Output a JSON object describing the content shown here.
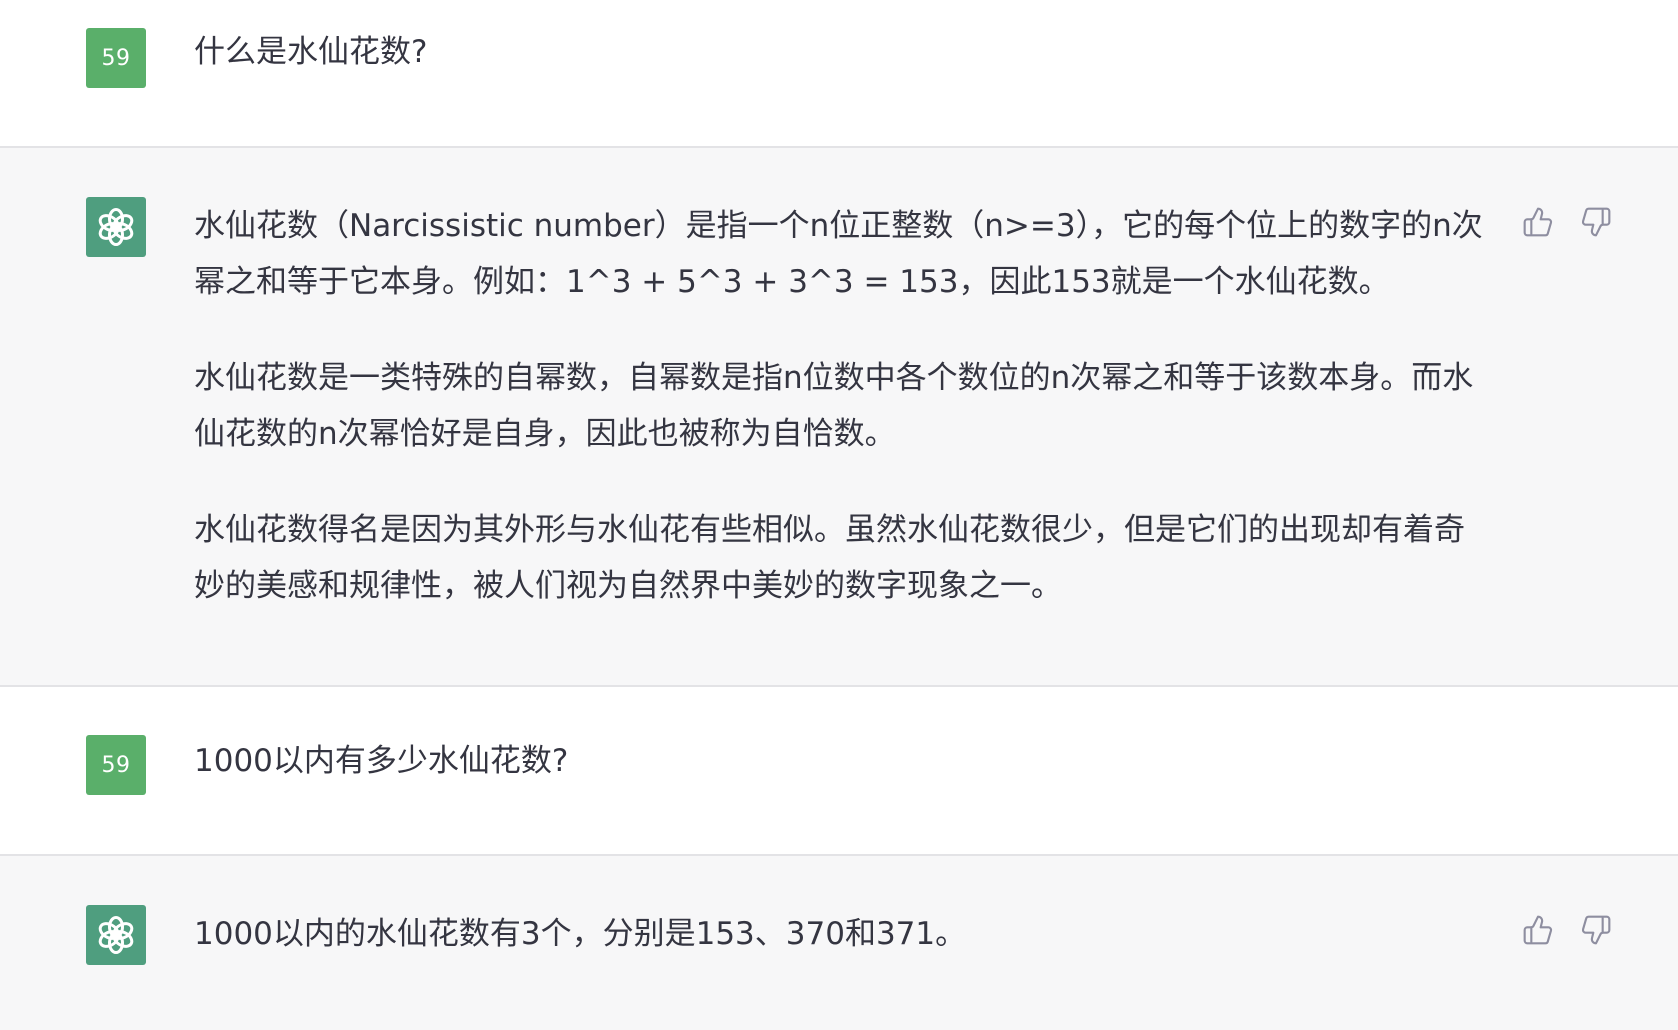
{
  "conversation": [
    {
      "role": "user",
      "avatar_text": "59",
      "paragraphs": [
        "什么是水仙花数?"
      ]
    },
    {
      "role": "assistant",
      "avatar_icon": "openai-logo-icon",
      "paragraphs": [
        "水仙花数（Narcissistic number）是指一个n位正整数（n>=3），它的每个位上的数字的n次幂之和等于它本身。例如：1^3 + 5^3 + 3^3 = 153，因此153就是一个水仙花数。",
        "水仙花数是一类特殊的自幂数，自幂数是指n位数中各个数位的n次幂之和等于该数本身。而水仙花数的n次幂恰好是自身，因此也被称为自恰数。",
        "水仙花数得名是因为其外形与水仙花有些相似。虽然水仙花数很少，但是它们的出现却有着奇妙的美感和规律性，被人们视为自然界中美妙的数字现象之一。"
      ],
      "feedback_icons": [
        "thumbs-up-icon",
        "thumbs-down-icon"
      ]
    },
    {
      "role": "user",
      "avatar_text": "59",
      "paragraphs": [
        "1000以内有多少水仙花数?"
      ]
    },
    {
      "role": "assistant",
      "avatar_icon": "openai-logo-icon",
      "paragraphs": [
        "1000以内的水仙花数有3个，分别是153、370和371。"
      ],
      "feedback_icons": [
        "thumbs-up-icon",
        "thumbs-down-icon"
      ]
    }
  ],
  "colors": {
    "user_avatar_bg": "#5aaf6a",
    "bot_avatar_bg": "#4f9e7f",
    "bot_row_bg": "#f7f7f8",
    "text": "#343541",
    "icon": "#8e8ea0"
  }
}
